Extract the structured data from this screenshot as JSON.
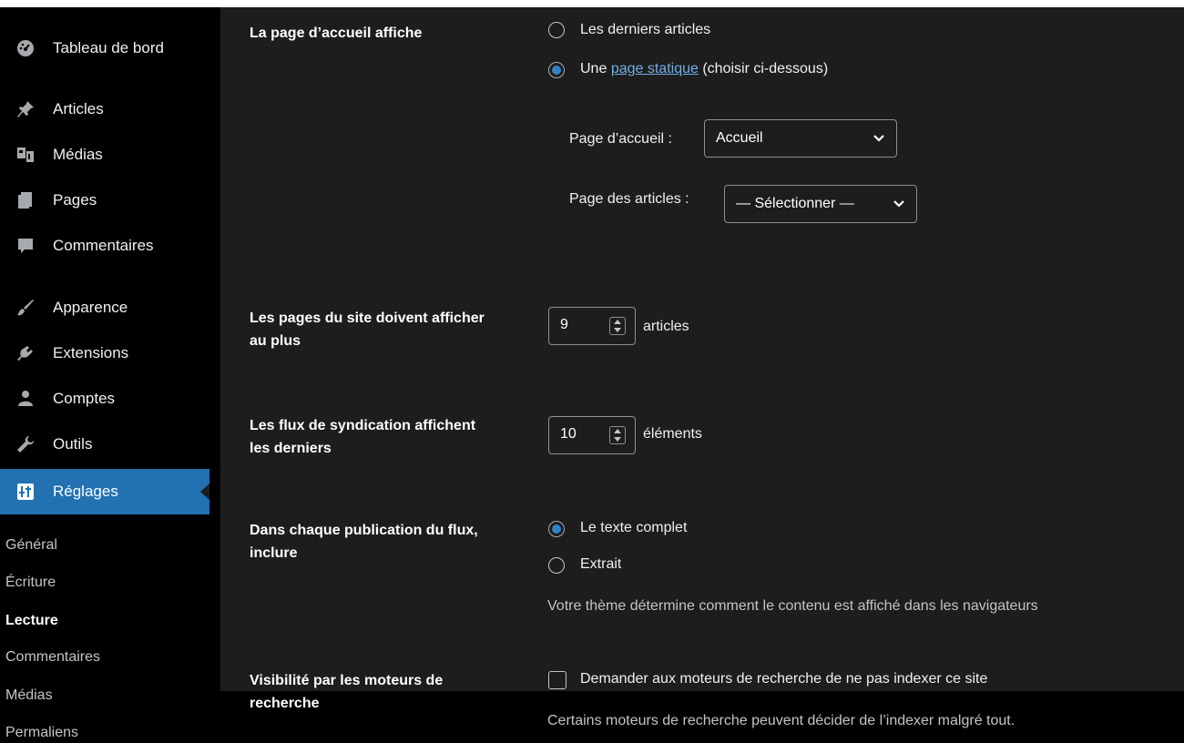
{
  "sidebar": {
    "items": [
      {
        "label": "Tableau de bord",
        "icon": "dashboard-icon"
      },
      {
        "label": "Articles",
        "icon": "pin-icon"
      },
      {
        "label": "Médias",
        "icon": "media-icon"
      },
      {
        "label": "Pages",
        "icon": "page-icon"
      },
      {
        "label": "Commentaires",
        "icon": "comment-icon"
      },
      {
        "label": "Apparence",
        "icon": "brush-icon"
      },
      {
        "label": "Extensions",
        "icon": "plugin-icon"
      },
      {
        "label": "Comptes",
        "icon": "user-icon"
      },
      {
        "label": "Outils",
        "icon": "wrench-icon"
      },
      {
        "label": "Réglages",
        "icon": "settings-icon"
      }
    ],
    "submenu": [
      "Général",
      "Écriture",
      "Lecture",
      "Commentaires",
      "Médias",
      "Permaliens"
    ],
    "active_accent": "#2271b1"
  },
  "homepage": {
    "label": "La page d’accueil affiche",
    "option_latest": "Les derniers articles",
    "option_static_prefix": "Une",
    "option_static_link": "page statique",
    "option_static_suffix": "(choisir ci-dessous)",
    "front_page_label": "Page d’accueil :",
    "front_page_value": "Accueil",
    "posts_page_label": "Page des articles :",
    "posts_page_value": "— Sélectionner —"
  },
  "posts_per_page": {
    "label": "Les pages du site doivent afficher au plus",
    "value": "9",
    "suffix": "articles"
  },
  "feed_items": {
    "label": "Les flux de syndication affichent les derniers",
    "value": "10",
    "suffix": "éléments"
  },
  "feed_content": {
    "label": "Dans chaque publication du flux, inclure",
    "option_full": "Le texte complet",
    "option_excerpt": "Extrait",
    "description": "Votre thème détermine comment le contenu est affiché dans les navigateurs"
  },
  "search_visibility": {
    "label": "Visibilité par les moteurs de recherche",
    "checkbox_label": "Demander aux moteurs de recherche de ne pas indexer ce site",
    "description": "Certains moteurs de recherche peuvent décider de l’indexer malgré tout."
  }
}
